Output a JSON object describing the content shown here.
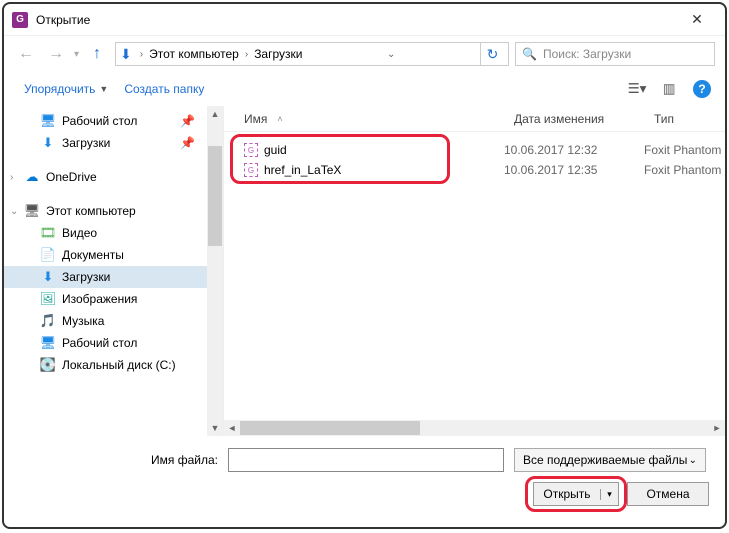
{
  "title": "Открытие",
  "app_icon_letter": "G",
  "breadcrumb": {
    "pc": "Этот компьютер",
    "folder": "Загрузки"
  },
  "search": {
    "placeholder": "Поиск: Загрузки"
  },
  "toolbar": {
    "organize": "Упорядочить",
    "new_folder": "Создать папку"
  },
  "columns": {
    "name": "Имя",
    "date": "Дата изменения",
    "type": "Тип"
  },
  "sidebar": {
    "desktop": "Рабочий стол",
    "downloads": "Загрузки",
    "onedrive": "OneDrive",
    "this_pc": "Этот компьютер",
    "video": "Видео",
    "documents": "Документы",
    "downloads2": "Загрузки",
    "images": "Изображения",
    "music": "Музыка",
    "desktop2": "Рабочий стол",
    "local_disk": "Локальный диск (C:)"
  },
  "files": [
    {
      "name": "guid",
      "date": "10.06.2017 12:32",
      "type": "Foxit Phantom"
    },
    {
      "name": "href_in_LaTeX",
      "date": "10.06.2017 12:35",
      "type": "Foxit Phantom"
    }
  ],
  "bottom": {
    "filename_label": "Имя файла:",
    "filename_value": "",
    "filter": "Все поддерживаемые файлы",
    "open": "Открыть",
    "cancel": "Отмена"
  }
}
